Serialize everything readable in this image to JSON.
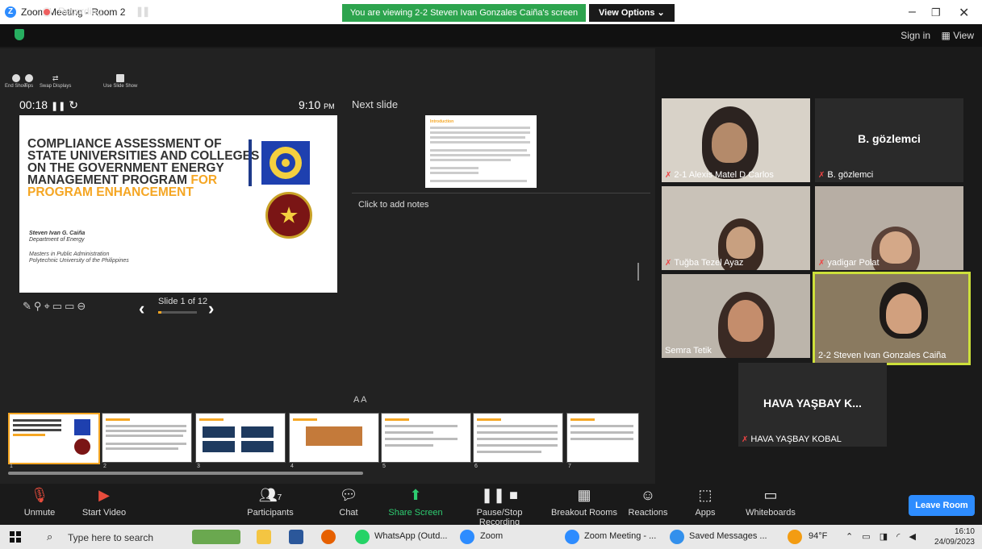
{
  "window": {
    "title": "Zoom Meeting - Room 2"
  },
  "viewing_banner": "You are viewing 2-2 Steven Ivan Gonzales Caiña's screen",
  "view_options_label": "View Options",
  "topbar": {
    "recording_label": "Recording...",
    "sign_in": "Sign in",
    "view": "View"
  },
  "presenter_tools": [
    {
      "label": "End Show",
      "icon": "close-circle-icon"
    },
    {
      "label": "Tips",
      "icon": "info-icon"
    },
    {
      "label": "Swap Displays",
      "icon": "swap-icon"
    },
    {
      "label": "Use Slide Show",
      "icon": "slideshow-icon"
    }
  ],
  "presenter": {
    "elapsed": "00:18",
    "clock_time": "9:10",
    "clock_ampm": "PM",
    "next_slide_label": "Next slide",
    "notes_placeholder": "Click to add notes",
    "font_size_control": "A A",
    "slide_counter": "Slide 1 of 12",
    "slide_progress_fraction": 0.0833
  },
  "current_slide": {
    "title_part1": "COMPLIANCE ASSESSMENT OF STATE UNIVERSITIES AND COLLEGES ON THE GOVERNMENT ENERGY MANAGEMENT PROGRAM",
    "title_part2": "FOR PROGRAM ENHANCEMENT",
    "author": "Steven Ivan G. Caiña",
    "department": "Department of Energy",
    "degree": "Masters in Public Administration",
    "university": "Polytechnic University of the Philippines"
  },
  "next_slide": {
    "heading": "Introduction"
  },
  "filmstrip": {
    "numbers": [
      "1",
      "2",
      "3",
      "4",
      "5",
      "6",
      "7"
    ]
  },
  "participants": [
    {
      "name": "2-1 Alexis Matel D Carlos",
      "muted": true,
      "video": true
    },
    {
      "name": "B. gözlemci",
      "muted": true,
      "video": false,
      "display": "B. gözlemci"
    },
    {
      "name": "Tuğba Tezel Ayaz",
      "muted": true,
      "video": true
    },
    {
      "name": "yadigar Polat",
      "muted": true,
      "video": true
    },
    {
      "name": "Semra Tetik",
      "muted": false,
      "video": true
    },
    {
      "name": "2-2 Steven Ivan Gonzales Caiña",
      "muted": false,
      "video": true,
      "active_speaker": true
    },
    {
      "name": "HAVA YAŞBAY KOBAL",
      "muted": true,
      "video": false,
      "display": "HAVA YAŞBAY K..."
    }
  ],
  "toolbar": {
    "unmute": "Unmute",
    "start_video": "Start Video",
    "participants": "Participants",
    "participants_count": "7",
    "chat": "Chat",
    "share_screen": "Share Screen",
    "pause_recording": "Pause/Stop Recording",
    "breakout_rooms": "Breakout Rooms",
    "reactions": "Reactions",
    "apps": "Apps",
    "whiteboards": "Whiteboards",
    "leave_room": "Leave Room"
  },
  "taskbar": {
    "search_placeholder": "Type here to search",
    "apps": [
      "WhatsApp (Outd...",
      "Zoom",
      "Zoom Meeting - ...",
      "Saved Messages ..."
    ],
    "weather": "94°F",
    "time": "16:10",
    "date": "24/09/2023"
  },
  "colors": {
    "accent_green": "#2da44e",
    "zoom_blue": "#2d8cff",
    "slide_orange": "#f5a623",
    "active_speaker": "#cde03a"
  }
}
